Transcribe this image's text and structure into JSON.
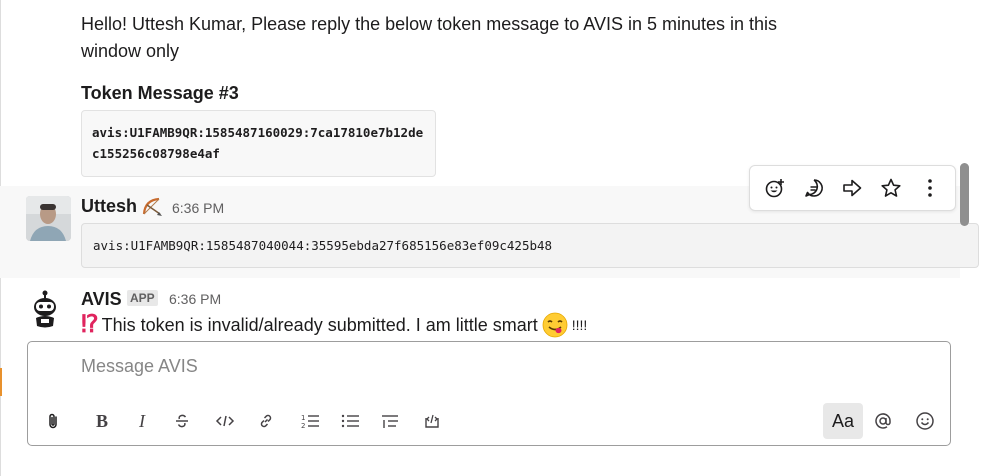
{
  "previous_message": {
    "text": "Hello! Uttesh Kumar, Please reply the below token message to AVIS in 5 minutes in this window only",
    "token_heading": "Token Message #3",
    "token_code": "avis:U1FAMB9QR:1585487160029:7ca17810e7b12dec155256c08798e4af"
  },
  "user_message": {
    "sender": "Uttesh",
    "status_icon": "bow-and-arrow-icon",
    "time": "6:36 PM",
    "code": "avis:U1FAMB9QR:1585487040044:35595ebda27f685156e83ef09c425b48"
  },
  "message_actions": [
    "add-reaction-icon",
    "reply-in-thread-icon",
    "share-message-icon",
    "save-star-icon",
    "more-actions-icon"
  ],
  "bot_message": {
    "sender": "AVIS",
    "badge": "APP",
    "time": "6:36 PM",
    "prefix_emoji": "⁉",
    "text": "This token is invalid/already submitted. I am little smart",
    "emoji": "savoring-face-emoji",
    "suffix": "!!!!"
  },
  "composer": {
    "placeholder": "Message AVIS",
    "toolbar": [
      "attach-icon",
      "bold-icon",
      "italic-icon",
      "strikethrough-icon",
      "code-icon",
      "link-icon",
      "ordered-list-icon",
      "bulleted-list-icon",
      "blockquote-icon",
      "code-block-icon",
      "formatting-toggle",
      "mention-icon",
      "emoji-icon"
    ],
    "format_label": "Aa"
  },
  "colors": {
    "accent_orange": "#e8912d",
    "hover_background": "#f8f8f8",
    "text": "#1d1c1d",
    "muted": "#616061"
  }
}
